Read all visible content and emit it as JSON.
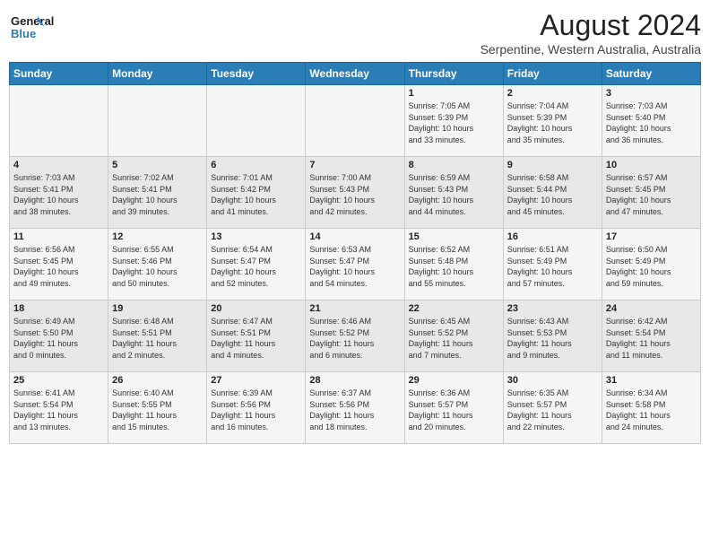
{
  "logo": {
    "line1": "General",
    "line2": "Blue"
  },
  "title": "August 2024",
  "subtitle": "Serpentine, Western Australia, Australia",
  "days_of_week": [
    "Sunday",
    "Monday",
    "Tuesday",
    "Wednesday",
    "Thursday",
    "Friday",
    "Saturday"
  ],
  "weeks": [
    [
      {
        "day": "",
        "content": ""
      },
      {
        "day": "",
        "content": ""
      },
      {
        "day": "",
        "content": ""
      },
      {
        "day": "",
        "content": ""
      },
      {
        "day": "1",
        "content": "Sunrise: 7:05 AM\nSunset: 5:39 PM\nDaylight: 10 hours\nand 33 minutes."
      },
      {
        "day": "2",
        "content": "Sunrise: 7:04 AM\nSunset: 5:39 PM\nDaylight: 10 hours\nand 35 minutes."
      },
      {
        "day": "3",
        "content": "Sunrise: 7:03 AM\nSunset: 5:40 PM\nDaylight: 10 hours\nand 36 minutes."
      }
    ],
    [
      {
        "day": "4",
        "content": "Sunrise: 7:03 AM\nSunset: 5:41 PM\nDaylight: 10 hours\nand 38 minutes."
      },
      {
        "day": "5",
        "content": "Sunrise: 7:02 AM\nSunset: 5:41 PM\nDaylight: 10 hours\nand 39 minutes."
      },
      {
        "day": "6",
        "content": "Sunrise: 7:01 AM\nSunset: 5:42 PM\nDaylight: 10 hours\nand 41 minutes."
      },
      {
        "day": "7",
        "content": "Sunrise: 7:00 AM\nSunset: 5:43 PM\nDaylight: 10 hours\nand 42 minutes."
      },
      {
        "day": "8",
        "content": "Sunrise: 6:59 AM\nSunset: 5:43 PM\nDaylight: 10 hours\nand 44 minutes."
      },
      {
        "day": "9",
        "content": "Sunrise: 6:58 AM\nSunset: 5:44 PM\nDaylight: 10 hours\nand 45 minutes."
      },
      {
        "day": "10",
        "content": "Sunrise: 6:57 AM\nSunset: 5:45 PM\nDaylight: 10 hours\nand 47 minutes."
      }
    ],
    [
      {
        "day": "11",
        "content": "Sunrise: 6:56 AM\nSunset: 5:45 PM\nDaylight: 10 hours\nand 49 minutes."
      },
      {
        "day": "12",
        "content": "Sunrise: 6:55 AM\nSunset: 5:46 PM\nDaylight: 10 hours\nand 50 minutes."
      },
      {
        "day": "13",
        "content": "Sunrise: 6:54 AM\nSunset: 5:47 PM\nDaylight: 10 hours\nand 52 minutes."
      },
      {
        "day": "14",
        "content": "Sunrise: 6:53 AM\nSunset: 5:47 PM\nDaylight: 10 hours\nand 54 minutes."
      },
      {
        "day": "15",
        "content": "Sunrise: 6:52 AM\nSunset: 5:48 PM\nDaylight: 10 hours\nand 55 minutes."
      },
      {
        "day": "16",
        "content": "Sunrise: 6:51 AM\nSunset: 5:49 PM\nDaylight: 10 hours\nand 57 minutes."
      },
      {
        "day": "17",
        "content": "Sunrise: 6:50 AM\nSunset: 5:49 PM\nDaylight: 10 hours\nand 59 minutes."
      }
    ],
    [
      {
        "day": "18",
        "content": "Sunrise: 6:49 AM\nSunset: 5:50 PM\nDaylight: 11 hours\nand 0 minutes."
      },
      {
        "day": "19",
        "content": "Sunrise: 6:48 AM\nSunset: 5:51 PM\nDaylight: 11 hours\nand 2 minutes."
      },
      {
        "day": "20",
        "content": "Sunrise: 6:47 AM\nSunset: 5:51 PM\nDaylight: 11 hours\nand 4 minutes."
      },
      {
        "day": "21",
        "content": "Sunrise: 6:46 AM\nSunset: 5:52 PM\nDaylight: 11 hours\nand 6 minutes."
      },
      {
        "day": "22",
        "content": "Sunrise: 6:45 AM\nSunset: 5:52 PM\nDaylight: 11 hours\nand 7 minutes."
      },
      {
        "day": "23",
        "content": "Sunrise: 6:43 AM\nSunset: 5:53 PM\nDaylight: 11 hours\nand 9 minutes."
      },
      {
        "day": "24",
        "content": "Sunrise: 6:42 AM\nSunset: 5:54 PM\nDaylight: 11 hours\nand 11 minutes."
      }
    ],
    [
      {
        "day": "25",
        "content": "Sunrise: 6:41 AM\nSunset: 5:54 PM\nDaylight: 11 hours\nand 13 minutes."
      },
      {
        "day": "26",
        "content": "Sunrise: 6:40 AM\nSunset: 5:55 PM\nDaylight: 11 hours\nand 15 minutes."
      },
      {
        "day": "27",
        "content": "Sunrise: 6:39 AM\nSunset: 5:56 PM\nDaylight: 11 hours\nand 16 minutes."
      },
      {
        "day": "28",
        "content": "Sunrise: 6:37 AM\nSunset: 5:56 PM\nDaylight: 11 hours\nand 18 minutes."
      },
      {
        "day": "29",
        "content": "Sunrise: 6:36 AM\nSunset: 5:57 PM\nDaylight: 11 hours\nand 20 minutes."
      },
      {
        "day": "30",
        "content": "Sunrise: 6:35 AM\nSunset: 5:57 PM\nDaylight: 11 hours\nand 22 minutes."
      },
      {
        "day": "31",
        "content": "Sunrise: 6:34 AM\nSunset: 5:58 PM\nDaylight: 11 hours\nand 24 minutes."
      }
    ]
  ]
}
